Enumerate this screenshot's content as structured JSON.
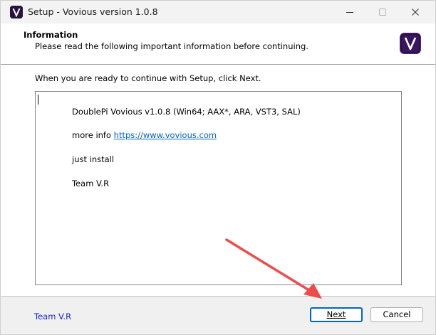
{
  "window": {
    "title": "Setup - Vovious version 1.0.8"
  },
  "header": {
    "title": "Information",
    "subtitle": "Please read the following important information before continuing."
  },
  "main": {
    "ready_text": "When you are ready to continue with Setup, click Next.",
    "memo": {
      "line1": "DoublePi Vovious v1.0.8 (Win64; AAX*, ARA, VST3, SAL)",
      "line2_prefix": "more info ",
      "line2_link": "https://www.vovious.com",
      "line3": "just install",
      "line4": "Team V.R"
    }
  },
  "footer": {
    "label": "Team V.R",
    "next_label": "Next",
    "cancel_label": "Cancel"
  },
  "colors": {
    "accent": "#0067c0",
    "link": "#0563c1",
    "footer_label": "#1b22c8",
    "annotation_arrow": "#ee4b4b"
  },
  "icons": {
    "app": "vovious-logo-icon",
    "minimize": "minimize-icon",
    "maximize": "maximize-icon",
    "close": "close-icon"
  }
}
